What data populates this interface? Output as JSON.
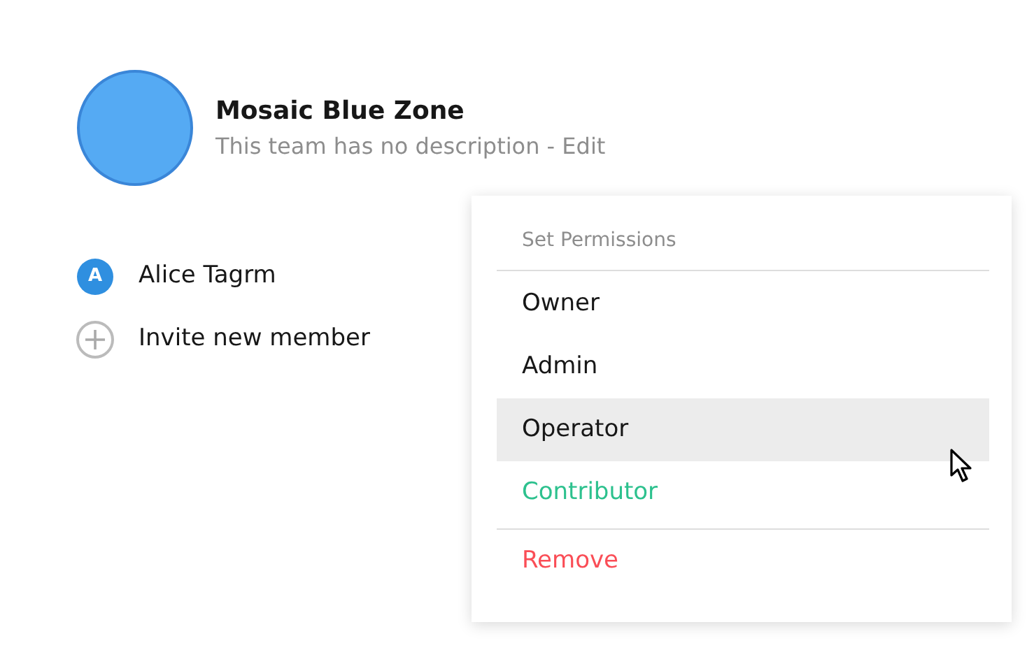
{
  "team": {
    "name": "Mosaic Blue Zone",
    "description": "This team has no description",
    "separator": "-",
    "edit_link": "Edit"
  },
  "members": [
    {
      "kind": "member",
      "initial": "A",
      "name": "Alice Tagrm"
    },
    {
      "kind": "invite",
      "name": "Invite new member"
    }
  ],
  "menu": {
    "header": "Set Permissions",
    "items": [
      {
        "label": "Owner",
        "selected": false,
        "hovered": false
      },
      {
        "label": "Admin",
        "selected": false,
        "hovered": false
      },
      {
        "label": "Operator",
        "selected": false,
        "hovered": true
      },
      {
        "label": "Contributor",
        "selected": true,
        "hovered": false
      }
    ],
    "remove_action": {
      "label": "Remove"
    }
  }
}
